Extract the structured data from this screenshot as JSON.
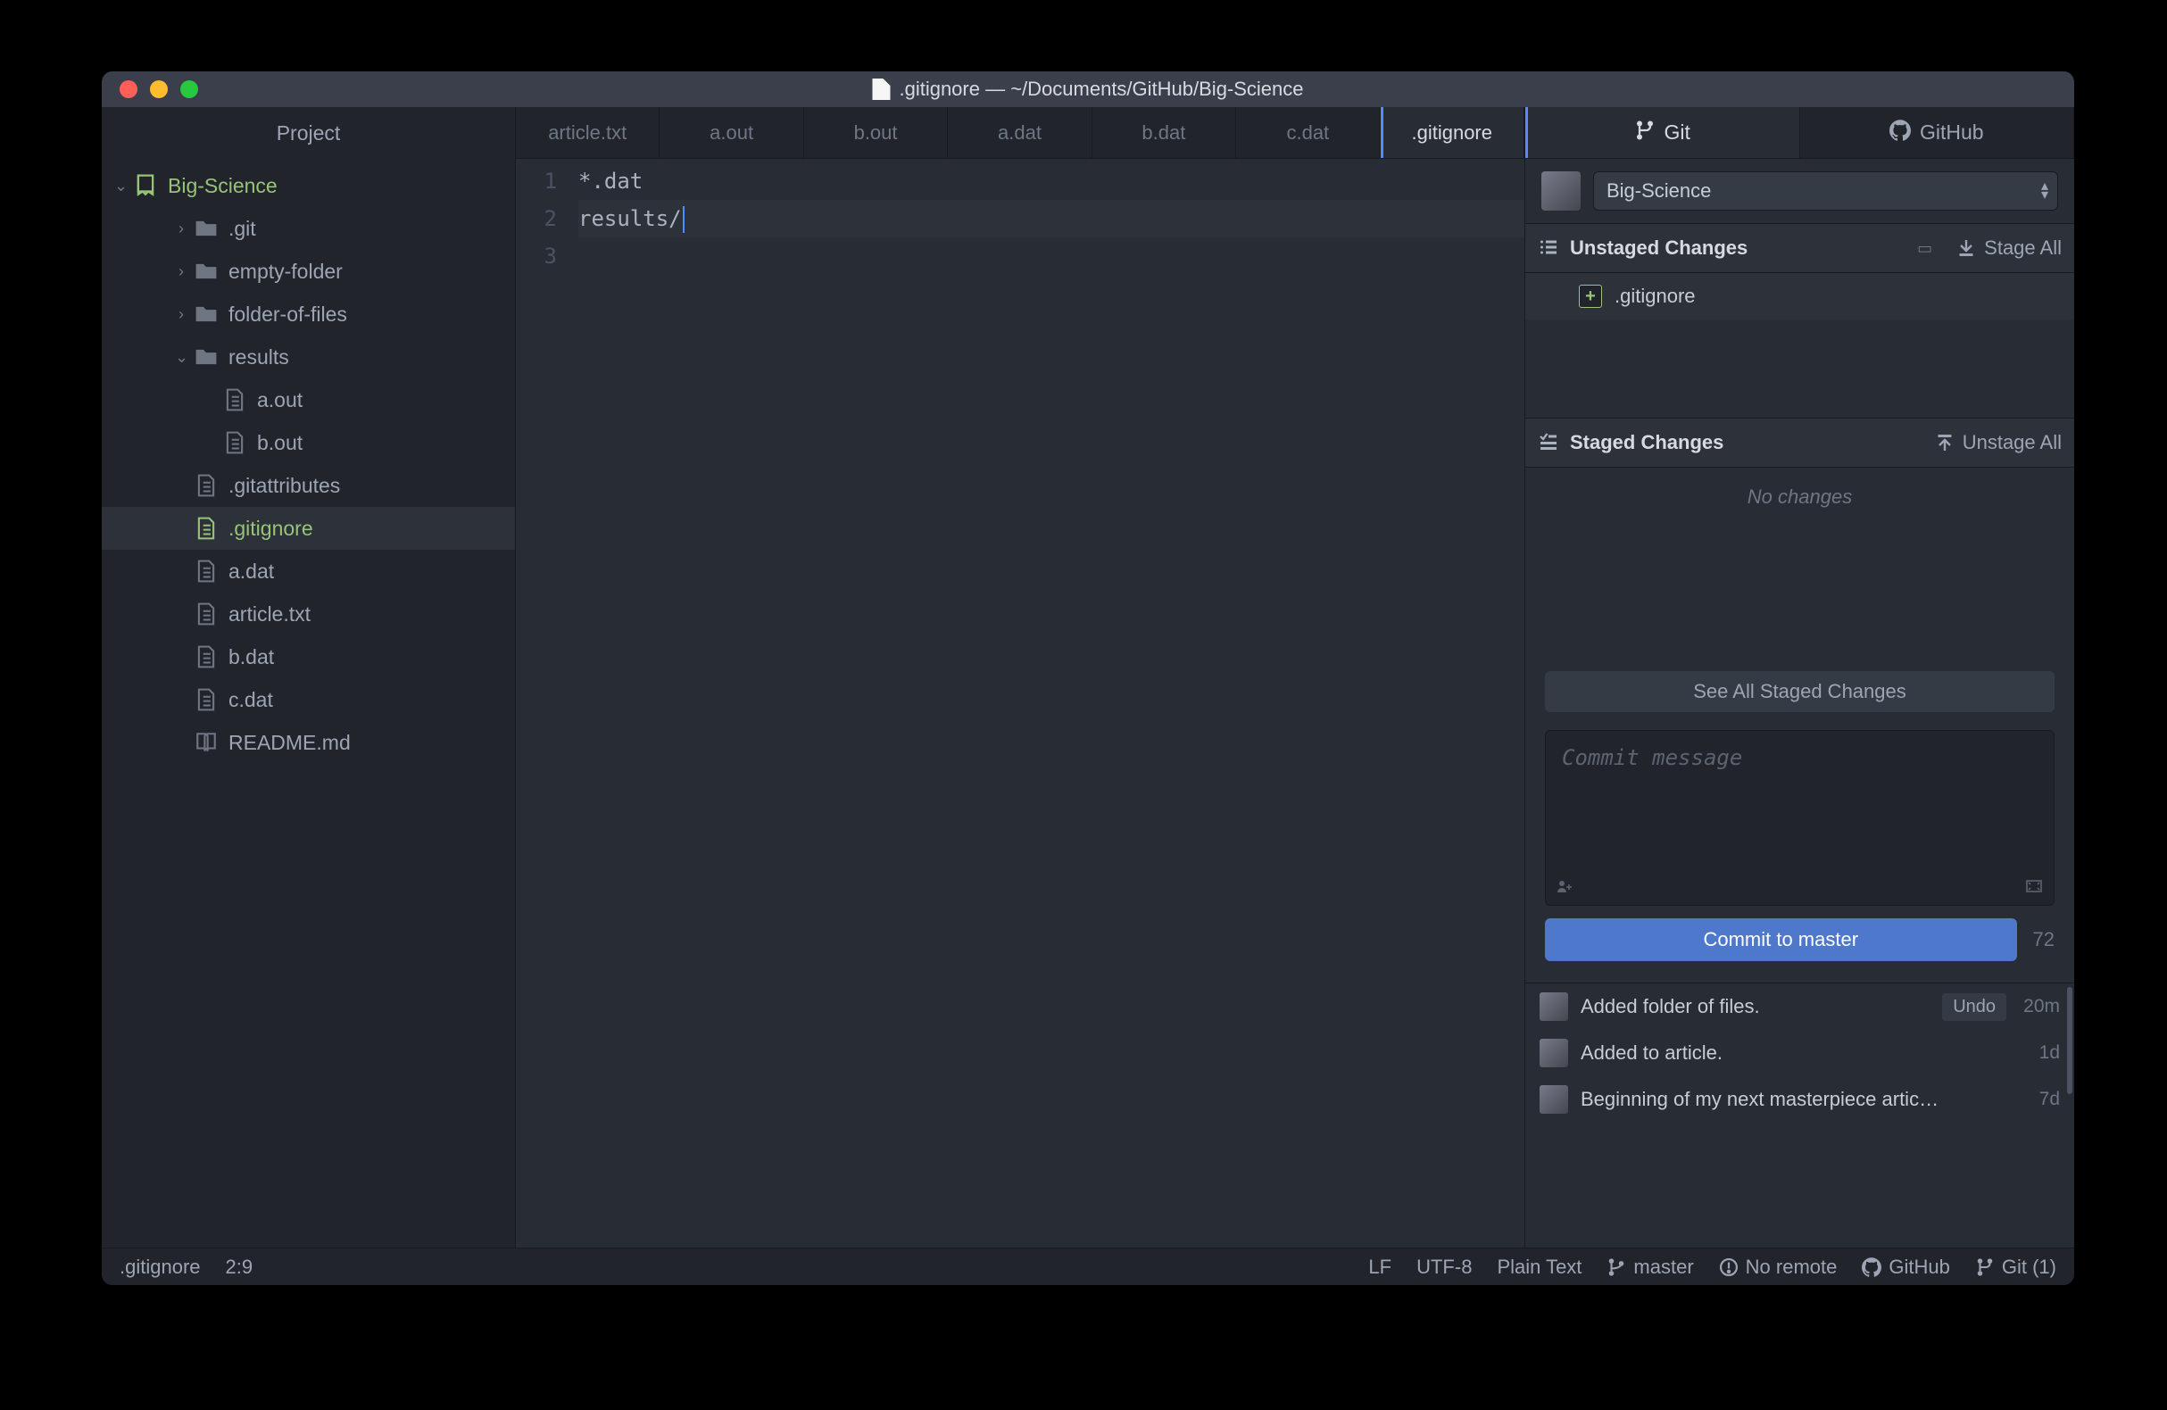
{
  "window_title": ".gitignore — ~/Documents/GitHub/Big-Science",
  "sidebar": {
    "header": "Project",
    "root": {
      "name": "Big-Science",
      "expanded": true
    },
    "items": [
      {
        "type": "folder",
        "name": ".git",
        "expanded": false,
        "depth": 1
      },
      {
        "type": "folder",
        "name": "empty-folder",
        "expanded": false,
        "depth": 1
      },
      {
        "type": "folder",
        "name": "folder-of-files",
        "expanded": false,
        "depth": 1
      },
      {
        "type": "folder",
        "name": "results",
        "expanded": true,
        "depth": 1
      },
      {
        "type": "file",
        "name": "a.out",
        "depth": 2
      },
      {
        "type": "file",
        "name": "b.out",
        "depth": 2
      },
      {
        "type": "file",
        "name": ".gitattributes",
        "depth": 1
      },
      {
        "type": "file",
        "name": ".gitignore",
        "depth": 1,
        "selected": true,
        "green": true
      },
      {
        "type": "file",
        "name": "a.dat",
        "depth": 1
      },
      {
        "type": "file",
        "name": "article.txt",
        "depth": 1
      },
      {
        "type": "file",
        "name": "b.dat",
        "depth": 1
      },
      {
        "type": "file",
        "name": "c.dat",
        "depth": 1
      },
      {
        "type": "file",
        "name": "README.md",
        "depth": 1,
        "icon": "book"
      }
    ]
  },
  "tabs": [
    {
      "label": "article.txt"
    },
    {
      "label": "a.out"
    },
    {
      "label": "b.out"
    },
    {
      "label": "a.dat"
    },
    {
      "label": "b.dat"
    },
    {
      "label": "c.dat"
    },
    {
      "label": ".gitignore",
      "active": true
    }
  ],
  "editor": {
    "lines": [
      "*.dat",
      "results/",
      ""
    ],
    "line_numbers": [
      "1",
      "2",
      "3"
    ],
    "cursor_line": 2
  },
  "git_panel": {
    "tabs": {
      "git": "Git",
      "github": "GitHub"
    },
    "repo": "Big-Science",
    "unstaged": {
      "label": "Unstaged Changes",
      "action": "Stage All",
      "items": [
        {
          "status": "+",
          "file": ".gitignore"
        }
      ]
    },
    "staged": {
      "label": "Staged Changes",
      "action": "Unstage All",
      "empty": "No changes",
      "see_all": "See All Staged Changes"
    },
    "commit": {
      "placeholder": "Commit message",
      "button": "Commit to master",
      "char_limit": "72"
    },
    "history": [
      {
        "msg": "Added folder of files.",
        "age": "20m",
        "undo": "Undo"
      },
      {
        "msg": "Added to article.",
        "age": "1d"
      },
      {
        "msg": "Beginning of my next masterpiece artic…",
        "age": "7d"
      }
    ]
  },
  "statusbar": {
    "file": ".gitignore",
    "cursor": "2:9",
    "line_ending": "LF",
    "encoding": "UTF-8",
    "grammar": "Plain Text",
    "branch": "master",
    "remote": "No remote",
    "github": "GitHub",
    "git": "Git (1)"
  }
}
